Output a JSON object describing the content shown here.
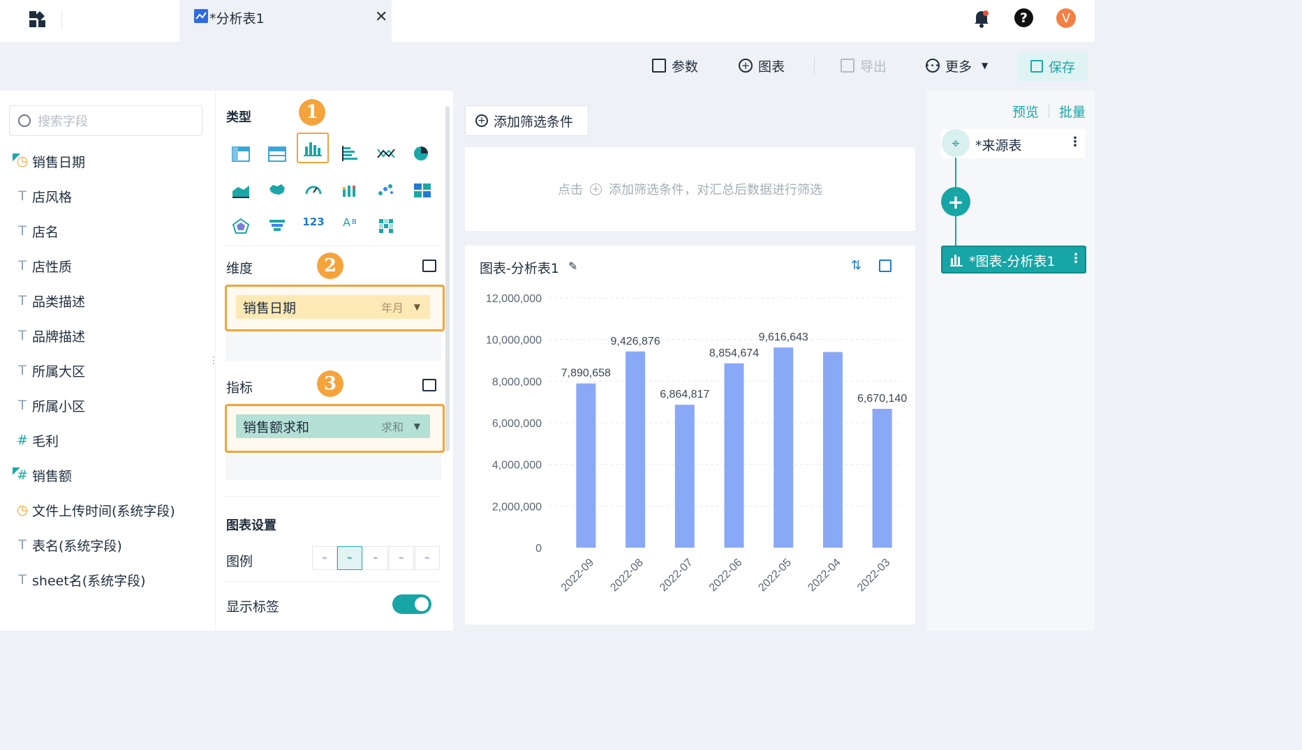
{
  "tab": {
    "title": "*分析表1"
  },
  "toolbar": {
    "params_label": "参数",
    "chart_label": "图表",
    "export_label": "导出",
    "more_label": "更多",
    "save_label": "保存"
  },
  "user": {
    "avatar_letter": "V"
  },
  "field_panel": {
    "search_placeholder": "搜索字段",
    "fields": [
      {
        "label": "销售日期",
        "icon": "date-icon"
      },
      {
        "label": "店风格",
        "icon": "text-icon"
      },
      {
        "label": "店名",
        "icon": "text-icon"
      },
      {
        "label": "店性质",
        "icon": "text-icon"
      },
      {
        "label": "品类描述",
        "icon": "text-icon"
      },
      {
        "label": "品牌描述",
        "icon": "text-icon"
      },
      {
        "label": "所属大区",
        "icon": "text-icon"
      },
      {
        "label": "所属小区",
        "icon": "text-icon"
      },
      {
        "label": "毛利",
        "icon": "number-icon"
      },
      {
        "label": "销售额",
        "icon": "number-icon"
      },
      {
        "label": "文件上传时间(系统字段)",
        "icon": "date-icon"
      },
      {
        "label": "表名(系统字段)",
        "icon": "text-icon"
      },
      {
        "label": "sheet名(系统字段)",
        "icon": "text-icon"
      }
    ]
  },
  "config": {
    "type_title": "类型",
    "dimension_title": "维度",
    "metric_title": "指标",
    "dimension_field": "销售日期",
    "dimension_agg": "年月",
    "metric_field": "销售额求和",
    "metric_agg": "求和",
    "chart_settings_title": "图表设置",
    "legend_label": "图例",
    "show_labels_label": "显示标签",
    "show_labels_on": true,
    "badges": [
      "1",
      "2",
      "3"
    ],
    "accent": "#f5a33b"
  },
  "filter": {
    "add_button": "添加筛选条件",
    "hint_prefix": "点击",
    "hint_suffix": "添加筛选条件，对汇总后数据进行筛选"
  },
  "chart_card": {
    "title": "图表-分析表1"
  },
  "right_panel": {
    "preview_label": "预览",
    "batch_label": "批量",
    "source_node": "*来源表",
    "chart_node": "*图表-分析表1",
    "accent": "#17a5a5"
  },
  "chart_data": {
    "type": "bar",
    "categories": [
      "2022-09",
      "2022-08",
      "2022-07",
      "2022-06",
      "2022-05",
      "2022-04",
      "2022-03"
    ],
    "values": [
      7890658,
      9426876,
      6864817,
      8854674,
      9616643,
      9400000,
      6670140
    ],
    "data_labels": [
      "7,890,658",
      "9,426,876",
      "6,864,817",
      "8,854,674",
      "9,616,643",
      "",
      "6,670,140"
    ],
    "y_ticks": [
      "0",
      "2,000,000",
      "4,000,000",
      "6,000,000",
      "8,000,000",
      "10,000,000",
      "12,000,000"
    ],
    "ylim": [
      0,
      12000000
    ],
    "bar_color": "#89a8f5",
    "grid": true
  }
}
